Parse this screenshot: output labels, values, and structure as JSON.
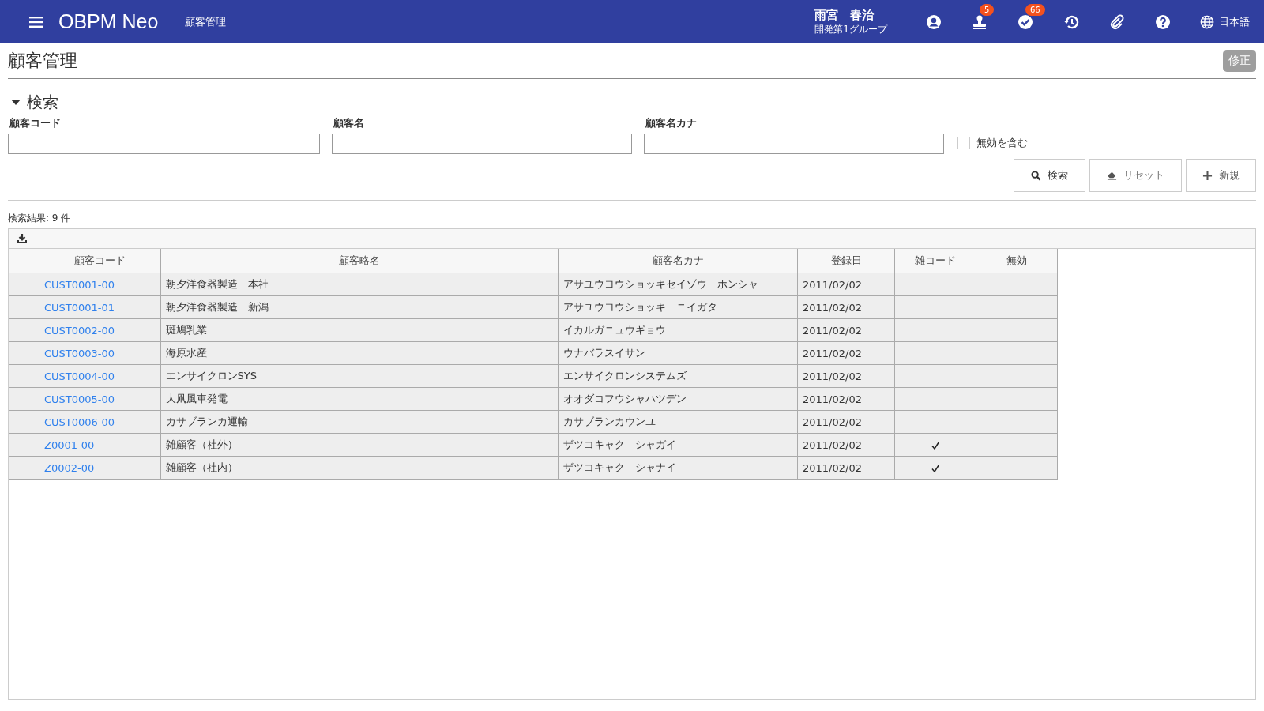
{
  "header": {
    "app_title": "OBPM Neo",
    "page_label": "顧客管理",
    "user_name": "雨宮　春治",
    "user_group": "開発第1グループ",
    "approval_badge": "5",
    "check_badge": "66",
    "language": "日本語"
  },
  "page": {
    "title": "顧客管理",
    "edit_button": "修正"
  },
  "search": {
    "heading": "検索",
    "expanded": true,
    "fields": [
      {
        "label": "顧客コード"
      },
      {
        "label": "顧客名"
      },
      {
        "label": "顧客名カナ"
      }
    ],
    "include_invalid": {
      "label": "無効を含む",
      "checked": false
    },
    "buttons": [
      {
        "kind": "search",
        "label": "検索"
      },
      {
        "kind": "reset",
        "label": "リセット"
      },
      {
        "kind": "new",
        "label": "新規"
      }
    ]
  },
  "results": {
    "count_text": "検索結果: 9 件",
    "columns": [
      "顧客コード",
      "顧客略名",
      "顧客名カナ",
      "登録日",
      "雑コード",
      "無効"
    ],
    "rows": [
      {
        "code": "CUST0001-00",
        "name": "朝夕洋食器製造　本社",
        "kana": "アサユウヨウショッキセイゾウ　ホンシャ",
        "date": "2011/02/02",
        "misc_code": false,
        "invalid": false
      },
      {
        "code": "CUST0001-01",
        "name": "朝夕洋食器製造　新潟",
        "kana": "アサユウヨウショッキ　ニイガタ",
        "date": "2011/02/02",
        "misc_code": false,
        "invalid": false
      },
      {
        "code": "CUST0002-00",
        "name": "斑鳩乳業",
        "kana": "イカルガニュウギョウ",
        "date": "2011/02/02",
        "misc_code": false,
        "invalid": false
      },
      {
        "code": "CUST0003-00",
        "name": "海原水産",
        "kana": "ウナバラスイサン",
        "date": "2011/02/02",
        "misc_code": false,
        "invalid": false
      },
      {
        "code": "CUST0004-00",
        "name": "エンサイクロンSYS",
        "kana": "エンサイクロンシステムズ",
        "date": "2011/02/02",
        "misc_code": false,
        "invalid": false
      },
      {
        "code": "CUST0005-00",
        "name": "大凧風車発電",
        "kana": "オオダコフウシャハツデン",
        "date": "2011/02/02",
        "misc_code": false,
        "invalid": false
      },
      {
        "code": "CUST0006-00",
        "name": "カサブランカ運輸",
        "kana": "カサブランカウンユ",
        "date": "2011/02/02",
        "misc_code": false,
        "invalid": false
      },
      {
        "code": "Z0001-00",
        "name": "雑顧客（社外）",
        "kana": "ザツコキャク　シャガイ",
        "date": "2011/02/02",
        "misc_code": true,
        "invalid": false
      },
      {
        "code": "Z0002-00",
        "name": "雑顧客（社内）",
        "kana": "ザツコキャク　シャナイ",
        "date": "2011/02/02",
        "misc_code": true,
        "invalid": false
      }
    ]
  }
}
